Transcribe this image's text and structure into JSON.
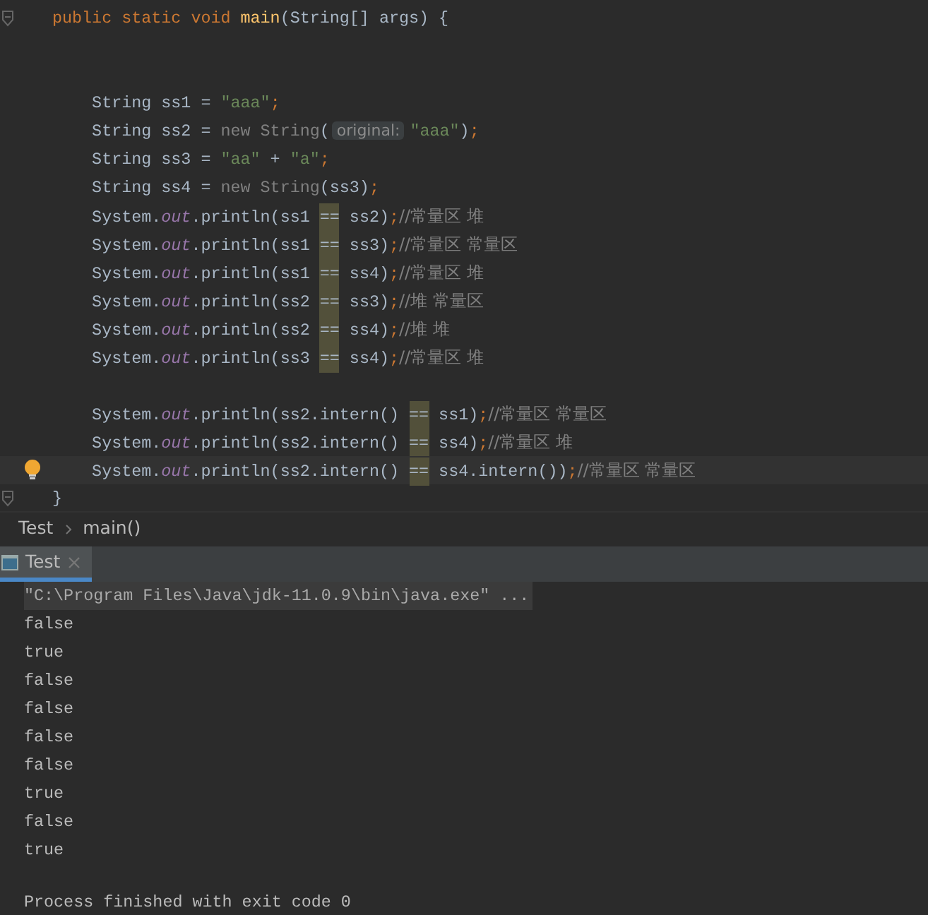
{
  "editor": {
    "blocks": [
      {
        "lines": [
          {
            "fold": true,
            "tokens": [
              {
                "kind": "kw",
                "text": "public static void "
              },
              {
                "kind": "fn",
                "text": "main"
              },
              {
                "kind": "plain",
                "text": "(String[] args) {"
              }
            ]
          }
        ]
      },
      {
        "lines": [
          {
            "tokens": [
              {
                "kind": "plain",
                "text": "    String ss1 = "
              },
              {
                "kind": "str",
                "text": "\"aaa\""
              },
              {
                "kind": "semi",
                "text": ";"
              }
            ]
          },
          {
            "tokens": [
              {
                "kind": "plain",
                "text": "    String ss2 = "
              },
              {
                "kind": "dim",
                "text": "new String"
              },
              {
                "kind": "plain",
                "text": "("
              },
              {
                "kind": "hint",
                "text": "original:"
              },
              {
                "kind": "str",
                "text": "\"aaa\""
              },
              {
                "kind": "plain",
                "text": ")"
              },
              {
                "kind": "semi",
                "text": ";"
              }
            ]
          },
          {
            "tokens": [
              {
                "kind": "plain",
                "text": "    String ss3 = "
              },
              {
                "kind": "str",
                "text": "\"aa\""
              },
              {
                "kind": "plain",
                "text": " + "
              },
              {
                "kind": "str",
                "text": "\"a\""
              },
              {
                "kind": "semi",
                "text": ";"
              }
            ]
          },
          {
            "tokens": [
              {
                "kind": "plain",
                "text": "    String ss4 = "
              },
              {
                "kind": "dim",
                "text": "new String"
              },
              {
                "kind": "plain",
                "text": "(ss3)"
              },
              {
                "kind": "semi",
                "text": ";"
              }
            ]
          },
          {
            "tokens": [
              {
                "kind": "plain",
                "text": "    System."
              },
              {
                "kind": "field",
                "text": "out"
              },
              {
                "kind": "plain",
                "text": ".println(ss1 "
              },
              {
                "kind": "match",
                "text": "=="
              },
              {
                "kind": "plain",
                "text": " ss2)"
              },
              {
                "kind": "semi",
                "text": ";"
              },
              {
                "kind": "comment",
                "text": "//常量区 堆"
              }
            ]
          },
          {
            "tokens": [
              {
                "kind": "plain",
                "text": "    System."
              },
              {
                "kind": "field",
                "text": "out"
              },
              {
                "kind": "plain",
                "text": ".println(ss1 "
              },
              {
                "kind": "match",
                "text": "=="
              },
              {
                "kind": "plain",
                "text": " ss3)"
              },
              {
                "kind": "semi",
                "text": ";"
              },
              {
                "kind": "comment",
                "text": "//常量区 常量区"
              }
            ]
          },
          {
            "tokens": [
              {
                "kind": "plain",
                "text": "    System."
              },
              {
                "kind": "field",
                "text": "out"
              },
              {
                "kind": "plain",
                "text": ".println(ss1 "
              },
              {
                "kind": "match",
                "text": "=="
              },
              {
                "kind": "plain",
                "text": " ss4)"
              },
              {
                "kind": "semi",
                "text": ";"
              },
              {
                "kind": "comment",
                "text": "//常量区 堆"
              }
            ]
          },
          {
            "tokens": [
              {
                "kind": "plain",
                "text": "    System."
              },
              {
                "kind": "field",
                "text": "out"
              },
              {
                "kind": "plain",
                "text": ".println(ss2 "
              },
              {
                "kind": "match",
                "text": "=="
              },
              {
                "kind": "plain",
                "text": " ss3)"
              },
              {
                "kind": "semi",
                "text": ";"
              },
              {
                "kind": "comment",
                "text": "//堆 常量区"
              }
            ]
          },
          {
            "tokens": [
              {
                "kind": "plain",
                "text": "    System."
              },
              {
                "kind": "field",
                "text": "out"
              },
              {
                "kind": "plain",
                "text": ".println(ss2 "
              },
              {
                "kind": "match",
                "text": "=="
              },
              {
                "kind": "plain",
                "text": " ss4)"
              },
              {
                "kind": "semi",
                "text": ";"
              },
              {
                "kind": "comment",
                "text": "//堆 堆"
              }
            ]
          },
          {
            "tokens": [
              {
                "kind": "plain",
                "text": "    System."
              },
              {
                "kind": "field",
                "text": "out"
              },
              {
                "kind": "plain",
                "text": ".println(ss3 "
              },
              {
                "kind": "match",
                "text": "=="
              },
              {
                "kind": "plain",
                "text": " ss4)"
              },
              {
                "kind": "semi",
                "text": ";"
              },
              {
                "kind": "comment",
                "text": "//常量区 堆"
              }
            ]
          }
        ]
      },
      {
        "lines": [
          {
            "tokens": [
              {
                "kind": "plain",
                "text": "    System."
              },
              {
                "kind": "field",
                "text": "out"
              },
              {
                "kind": "plain",
                "text": ".println(ss2.intern() "
              },
              {
                "kind": "match",
                "text": "=="
              },
              {
                "kind": "plain",
                "text": " ss1)"
              },
              {
                "kind": "semi",
                "text": ";"
              },
              {
                "kind": "comment",
                "text": "//常量区 常量区"
              }
            ]
          },
          {
            "tokens": [
              {
                "kind": "plain",
                "text": "    System."
              },
              {
                "kind": "field",
                "text": "out"
              },
              {
                "kind": "plain",
                "text": ".println(ss2.intern() "
              },
              {
                "kind": "match",
                "text": "=="
              },
              {
                "kind": "plain",
                "text": " ss4)"
              },
              {
                "kind": "semi",
                "text": ";"
              },
              {
                "kind": "comment",
                "text": "//常量区 堆"
              }
            ]
          },
          {
            "bulb": true,
            "current": true,
            "tokens": [
              {
                "kind": "plain",
                "text": "    System."
              },
              {
                "kind": "field",
                "text": "out"
              },
              {
                "kind": "plain",
                "text": ".println(ss2.intern() "
              },
              {
                "kind": "match",
                "text": "=="
              },
              {
                "kind": "plain",
                "text": " ss4.intern())"
              },
              {
                "kind": "semi",
                "text": ";"
              },
              {
                "kind": "comment",
                "text": "//常量区 常量区"
              }
            ]
          },
          {
            "fold": true,
            "tokens": [
              {
                "kind": "plain",
                "text": "}"
              }
            ]
          }
        ]
      }
    ]
  },
  "breadcrumb": [
    "Test",
    "main()"
  ],
  "run_tabs": [
    {
      "label": "Test",
      "selected": true
    }
  ],
  "console": {
    "command": "\"C:\\Program Files\\Java\\jdk-11.0.9\\bin\\java.exe\" ...",
    "output": [
      "false",
      "true",
      "false",
      "false",
      "false",
      "false",
      "true",
      "false",
      "true"
    ],
    "footer": "Process finished with exit code 0"
  }
}
